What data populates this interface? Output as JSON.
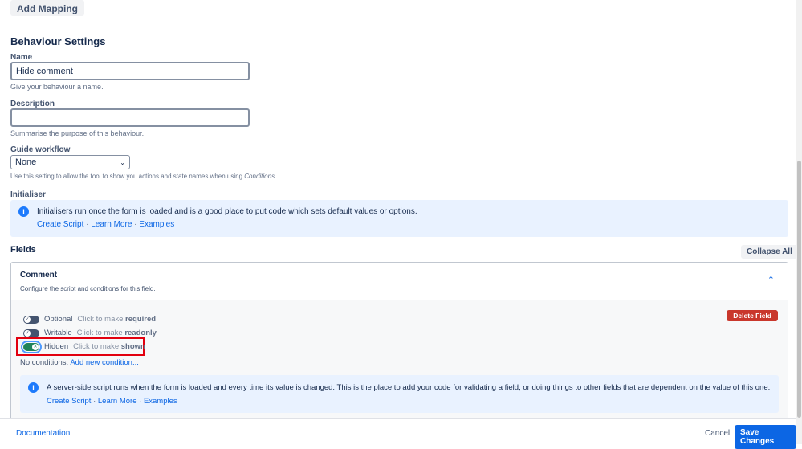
{
  "add_mapping": "Add Mapping",
  "section_title": "Behaviour Settings",
  "name": {
    "label": "Name",
    "value": "Hide comment",
    "help": "Give your behaviour a name."
  },
  "description": {
    "label": "Description",
    "value": "",
    "help": "Summarise the purpose of this behaviour."
  },
  "guide": {
    "label": "Guide workflow",
    "value": "None",
    "help": "Use this setting to allow the tool to show you actions and state names when using ",
    "help_em": "Conditions",
    "help_end": "."
  },
  "initialiser": {
    "label": "Initialiser",
    "text": "Initialisers run once the form is loaded and is a good place to put code which sets default values or options.",
    "links": [
      "Create Script",
      "Learn More",
      "Examples"
    ]
  },
  "fields": {
    "title": "Fields",
    "collapse_all": "Collapse All",
    "field": {
      "name": "Comment",
      "desc": "Configure the script and conditions for this field.",
      "delete": "Delete Field",
      "toggles": [
        {
          "name": "Optional",
          "hint": "Click to make ",
          "bold": "required"
        },
        {
          "name": "Writable",
          "hint": "Click to make ",
          "bold": "readonly"
        },
        {
          "name": "Hidden",
          "hint": "Click to make ",
          "bold": "shown"
        }
      ],
      "no_conditions": "No conditions.",
      "add_condition": "Add new condition...",
      "script_text": "A server-side script runs when the form is loaded and every time its value is changed. This is the place to add your code for validating a field, or doing things to other fields that are dependent on the value of this one.",
      "links": [
        "Create Script",
        "Learn More",
        "Examples"
      ]
    }
  },
  "footer": {
    "documentation": "Documentation",
    "cancel": "Cancel",
    "save": "Save Changes"
  },
  "colors": {
    "primary": "#0c66e4",
    "danger": "#c9372c",
    "highlight": "#e2000f"
  }
}
